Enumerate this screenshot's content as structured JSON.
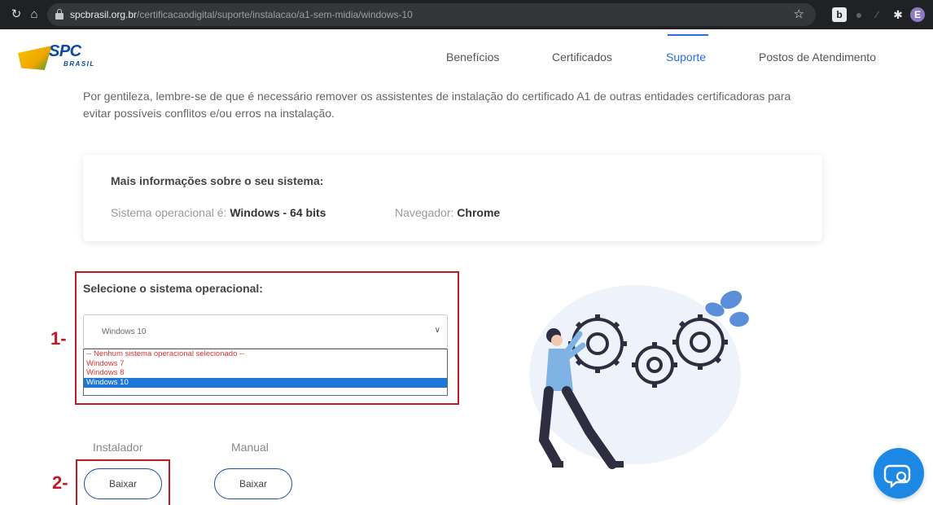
{
  "browser": {
    "url_host": "spcbrasil.org.br",
    "url_path": "/certificacaodigital/suporte/instalacao/a1-sem-midia/windows-10",
    "profile_initial": "E",
    "extension_letter": "b"
  },
  "header": {
    "logo_text": "SPC",
    "logo_subtext": "BRASIL",
    "nav": [
      {
        "label": "Benefícios"
      },
      {
        "label": "Certificados"
      },
      {
        "label": "Suporte"
      },
      {
        "label": "Postos de Atendimento"
      }
    ],
    "active_nav": "Suporte"
  },
  "notice": "Por gentileza, lembre-se de que é necessário remover os assistentes de instalação do certificado A1 de outras entidades certificadoras para evitar possíveis conflitos e/ou erros na instalação.",
  "info_card": {
    "title": "Mais informações sobre o seu sistema:",
    "os_label": "Sistema operacional é:",
    "os_value": "Windows - 64 bits",
    "browser_label": "Navegador:",
    "browser_value": "Chrome"
  },
  "os_select": {
    "label": "Selecione o sistema operacional:",
    "selected": "Windows 10",
    "options": [
      "-- Nenhum sistema operacional selecionado --",
      "Windows 7",
      "Windows 8",
      "Windows 10"
    ]
  },
  "downloads": {
    "installer_label": "Instalador",
    "installer_button": "Baixar",
    "manual_label": "Manual",
    "manual_button": "Baixar"
  },
  "annotations": {
    "step1": "1-",
    "step2": "2-"
  },
  "colors": {
    "accent": "#2a6fd6",
    "annotation": "#c0191f",
    "chat": "#1e88e5"
  }
}
